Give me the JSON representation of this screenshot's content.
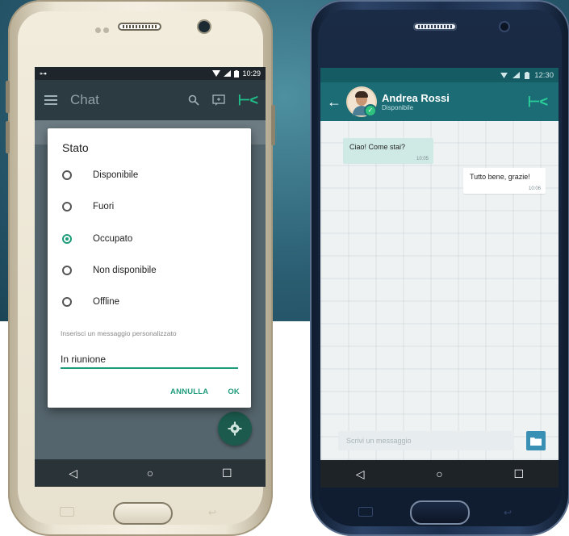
{
  "phone_left": {
    "status_bar": {
      "time": "10:29",
      "left_icon": "⊶",
      "icons": [
        "wifi-icon",
        "signal-icon",
        "battery-icon"
      ]
    },
    "app_bar": {
      "title": "Chat",
      "brand": "⊢<",
      "actions": [
        "search-icon",
        "compose-icon"
      ]
    },
    "dialog": {
      "title": "Stato",
      "options": [
        {
          "label": "Disponibile",
          "checked": false
        },
        {
          "label": "Fuori",
          "checked": false
        },
        {
          "label": "Occupato",
          "checked": true
        },
        {
          "label": "Non disponibile",
          "checked": false
        },
        {
          "label": "Offline",
          "checked": false
        }
      ],
      "hint": "Inserisci un messaggio personalizzato",
      "input_value": "In riunione",
      "cancel_label": "ANNULLA",
      "ok_label": "OK"
    },
    "nav": {
      "back": "◁",
      "home": "○",
      "recent": "☐"
    },
    "accent_color": "#1f9c7c"
  },
  "phone_right": {
    "status_bar": {
      "time": "12:30"
    },
    "app_bar": {
      "contact_name": "Andrea Rossi",
      "contact_status": "Disponibile",
      "back": "←",
      "brand": "⊢<"
    },
    "messages": [
      {
        "direction": "in",
        "text": "Ciao! Come stai?",
        "time": "10:05"
      },
      {
        "direction": "out",
        "text": "Tutto bene, grazie!",
        "time": "10:06"
      }
    ],
    "compose": {
      "placeholder": "Scrivi un messaggio"
    },
    "nav": {
      "back": "◁",
      "home": "○",
      "recent": "☐"
    },
    "header_color": "#1b6c74"
  }
}
